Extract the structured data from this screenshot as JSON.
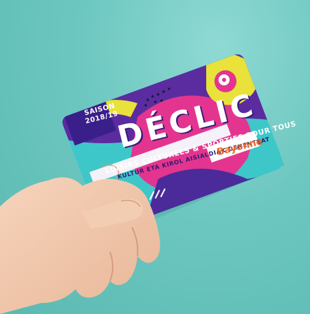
{
  "card": {
    "season_label": "SAISON",
    "season_years": "2018/19",
    "title": "DÉCLIC",
    "subtitle_fr": "LOISIRS CULTURELS & SPORTIFS POUR TOUS",
    "subtitle_eu": "KULTUR ETA KIROL AISIALDIAK DENENTZAT",
    "brand": "Bayonne"
  },
  "colors": {
    "background": "#6cc7c0",
    "skin": "#f0c7a8",
    "card_purple": "#5b2ca0",
    "card_pink": "#e3358f",
    "card_yellow": "#e8e23a",
    "card_teal": "#3cc8c8"
  }
}
